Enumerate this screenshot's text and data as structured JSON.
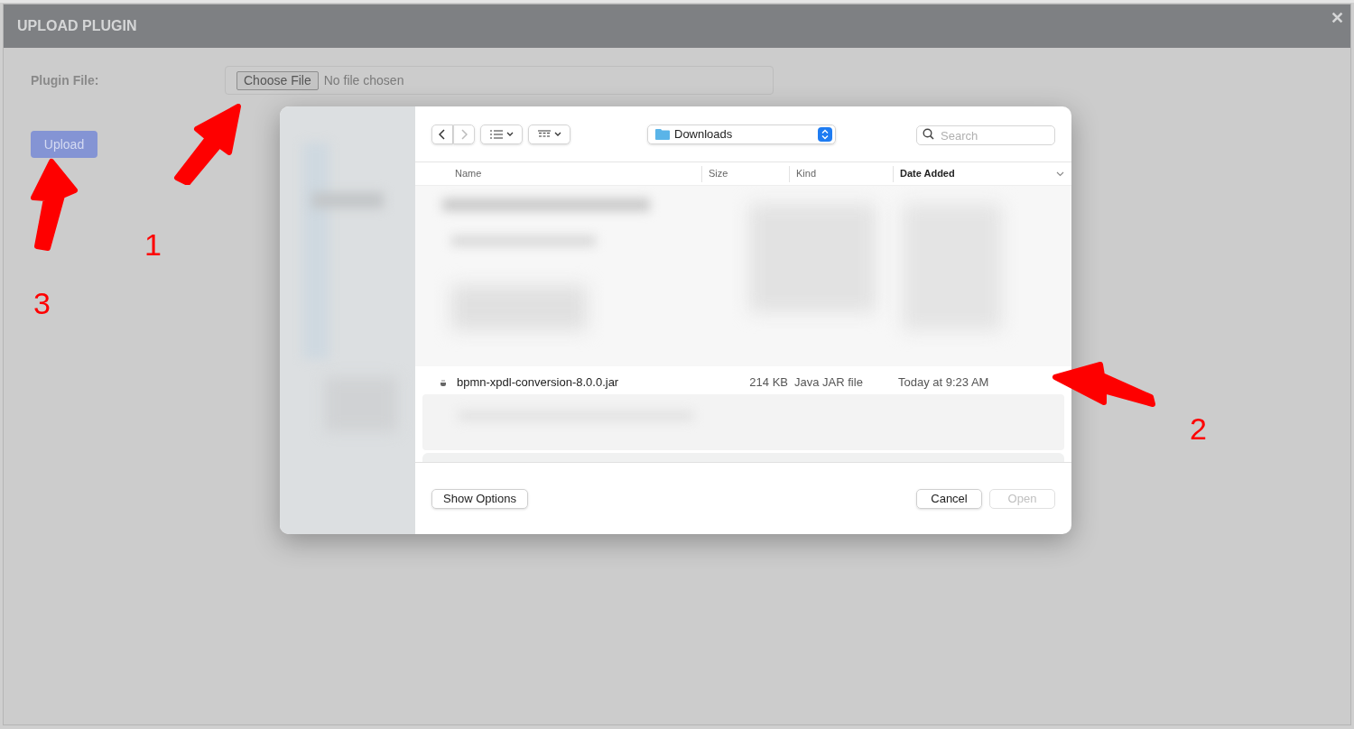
{
  "modal": {
    "title": "UPLOAD PLUGIN",
    "close": "✕",
    "label": "Plugin File:",
    "file_button": "Choose File",
    "file_status": "No file chosen",
    "upload": "Upload"
  },
  "dialog": {
    "location": "Downloads",
    "search": {
      "placeholder": "Search"
    },
    "columns": [
      {
        "label": "Name",
        "sorted": false
      },
      {
        "label": "Size",
        "sorted": false
      },
      {
        "label": "Kind",
        "sorted": false
      },
      {
        "label": "Date Added",
        "sorted": true
      }
    ],
    "files": [
      {
        "name": "bpmn-xpdl-conversion-8.0.0.jar",
        "size": "214 KB",
        "kind": "Java JAR file",
        "date": "Today at 9:23 AM"
      }
    ],
    "show_options": "Show Options",
    "cancel": "Cancel",
    "open": {
      "label": "Open",
      "disabled": true
    }
  },
  "annotations": [
    {
      "number": "1"
    },
    {
      "number": "2"
    },
    {
      "number": "3"
    }
  ]
}
